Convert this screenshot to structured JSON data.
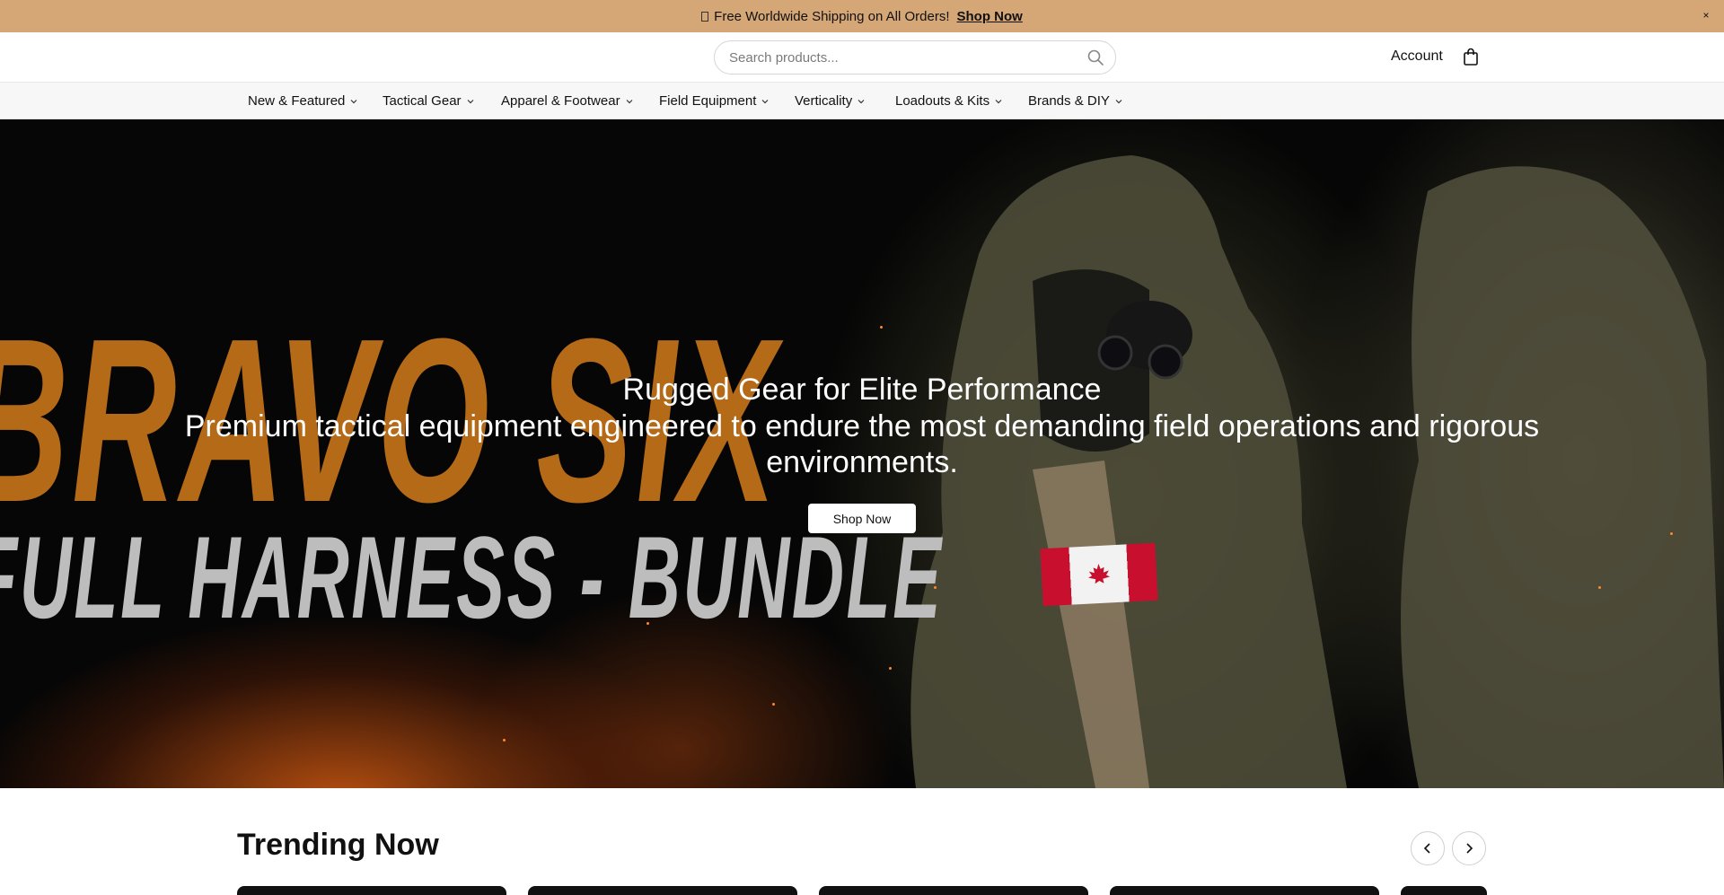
{
  "announcement": {
    "text": "Free Worldwide Shipping on All Orders!",
    "link": "Shop Now",
    "close": "×"
  },
  "header": {
    "search_placeholder": "Search products...",
    "account": "Account"
  },
  "nav": {
    "items": [
      {
        "label": "New & Featured"
      },
      {
        "label": "Tactical Gear"
      },
      {
        "label": "Apparel & Footwear"
      },
      {
        "label": "Field Equipment"
      },
      {
        "label": "Verticality"
      },
      {
        "label": "Loadouts & Kits"
      },
      {
        "label": "Brands & DIY"
      }
    ]
  },
  "hero": {
    "banner_line1": "BRAVO SIX",
    "banner_line2": "FULL HARNESS - BUNDLE",
    "title": "Rugged Gear for Elite Performance",
    "subtitle": "Premium tactical equipment engineered to endure the most demanding field operations and rigorous environments.",
    "cta": "Shop Now"
  },
  "trending": {
    "title": "Trending Now"
  },
  "colors": {
    "announcement_bg": "#d5a676",
    "accent_orange": "#b46a17",
    "hero_bg": "#060606"
  },
  "icons": [
    "search-icon",
    "bag-icon",
    "chevron-down-icon",
    "close-icon",
    "chevron-left-icon",
    "chevron-right-icon"
  ]
}
